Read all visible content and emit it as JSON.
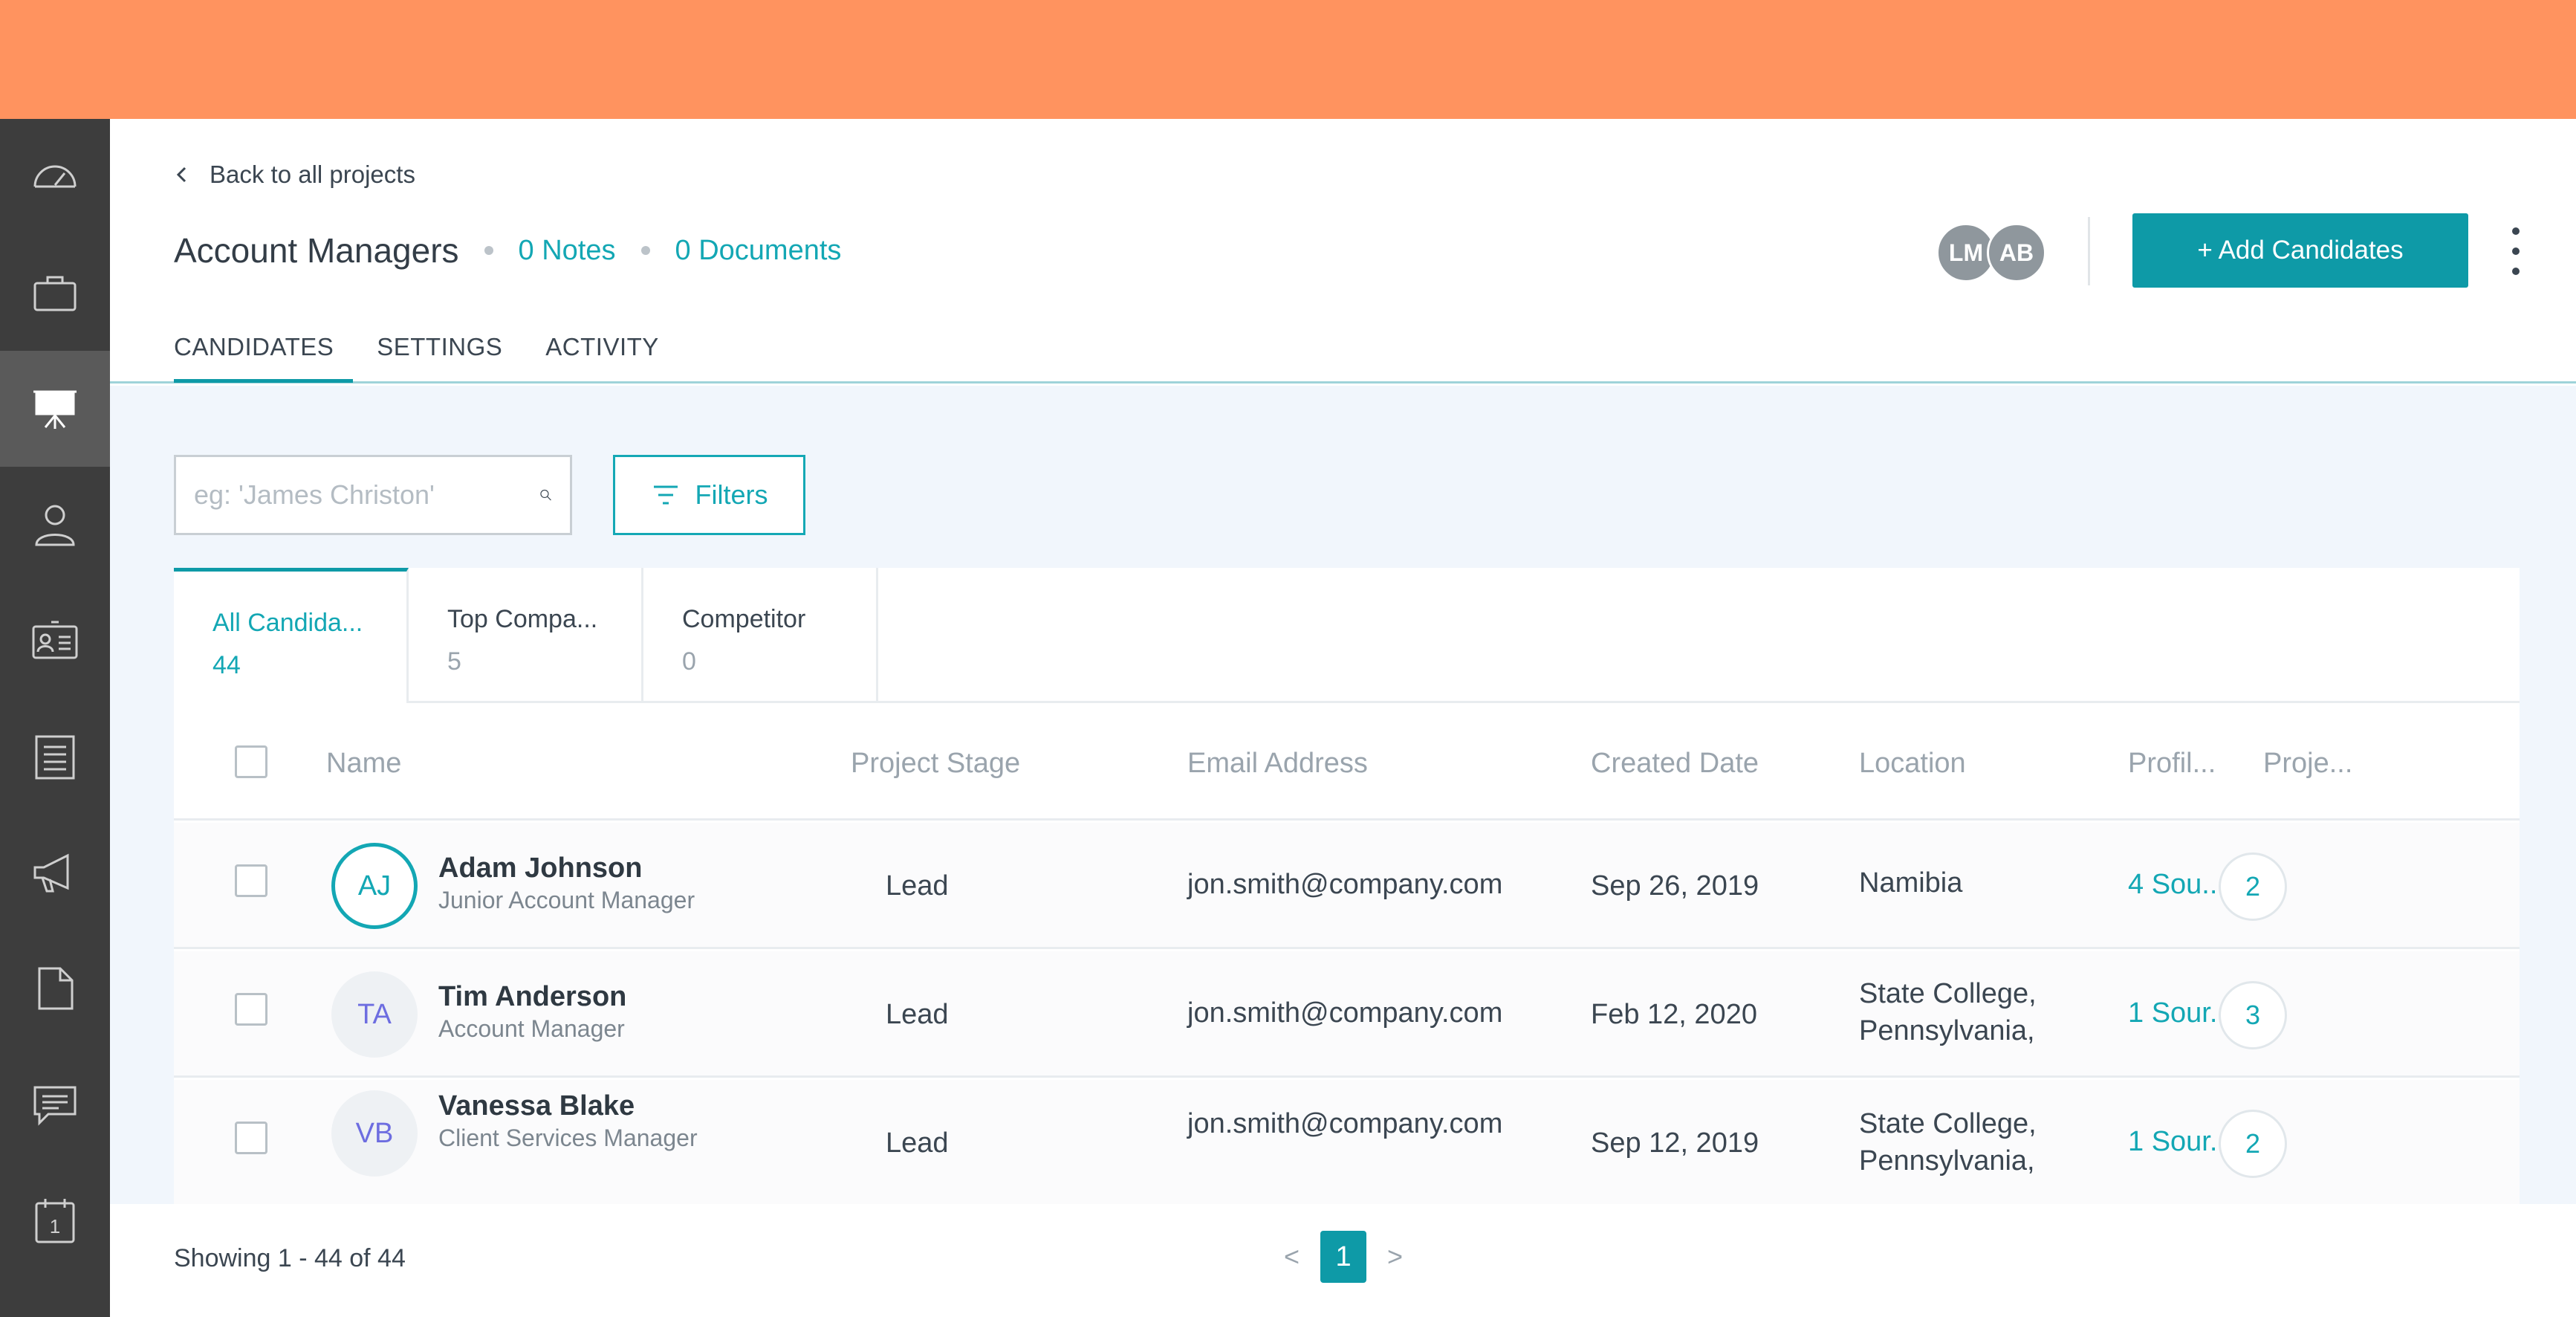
{
  "header": {
    "back_label": "Back to all projects",
    "title": "Account Managers",
    "notes_link": "0 Notes",
    "documents_link": "0 Documents",
    "collaborators": [
      "LM",
      "AB"
    ],
    "add_button": "+ Add Candidates",
    "tabs": [
      {
        "label": "CANDIDATES",
        "active": true
      },
      {
        "label": "SETTINGS",
        "active": false
      },
      {
        "label": "ACTIVITY",
        "active": false
      }
    ]
  },
  "sidebar": {
    "items": [
      {
        "icon": "dashboard-icon",
        "active": false
      },
      {
        "icon": "briefcase-icon",
        "active": false
      },
      {
        "icon": "presentation-icon",
        "active": true
      },
      {
        "icon": "person-icon",
        "active": false
      },
      {
        "icon": "id-card-icon",
        "active": false
      },
      {
        "icon": "list-icon",
        "active": false
      },
      {
        "icon": "megaphone-icon",
        "active": false
      },
      {
        "icon": "document-icon",
        "active": false
      },
      {
        "icon": "chat-icon",
        "active": false
      },
      {
        "icon": "calendar-icon",
        "active": false
      }
    ],
    "calendar_day": "1"
  },
  "search": {
    "placeholder": "eg: 'James Christon'"
  },
  "filters_label": "Filters",
  "segments": [
    {
      "label": "All Candida...",
      "count": "44",
      "active": true
    },
    {
      "label": "Top Compa...",
      "count": "5",
      "active": false
    },
    {
      "label": "Competitor",
      "count": "0",
      "active": false
    }
  ],
  "table": {
    "columns": [
      "Name",
      "Project Stage",
      "Email Address",
      "Created Date",
      "Location",
      "Profil...",
      "Proje..."
    ],
    "rows": [
      {
        "initials": "AJ",
        "name": "Adam Johnson",
        "title": "Junior Account Manager",
        "stage": "Lead",
        "email": "jon.smith@company.com",
        "created": "Sep 26, 2019",
        "location1": "Namibia",
        "location2": "",
        "profiles": "4 Sou...",
        "projects": "2"
      },
      {
        "initials": "TA",
        "name": "Tim Anderson",
        "title": "Account Manager",
        "stage": "Lead",
        "email": "jon.smith@company.com",
        "created": "Feb 12, 2020",
        "location1": "State College,",
        "location2": "Pennsylvania,",
        "profiles": "1 Sour...",
        "projects": "3"
      },
      {
        "initials": "VB",
        "name": "Vanessa Blake",
        "title": "Client Services Manager",
        "stage": "Lead",
        "email": "jon.smith@company.com",
        "created": "Sep 12, 2019",
        "location1": "State College,",
        "location2": "Pennsylvania,",
        "profiles": "1 Sour...",
        "projects": "2"
      }
    ]
  },
  "footer": {
    "showing": "Showing 1 - 44 of 44",
    "prev": "<",
    "page": "1",
    "next": ">"
  },
  "colors": {
    "topbar": "#ff935f",
    "sidebar": "#3d3d3d",
    "accent": "#0e9aa7",
    "content_bg": "#f1f6fc"
  }
}
